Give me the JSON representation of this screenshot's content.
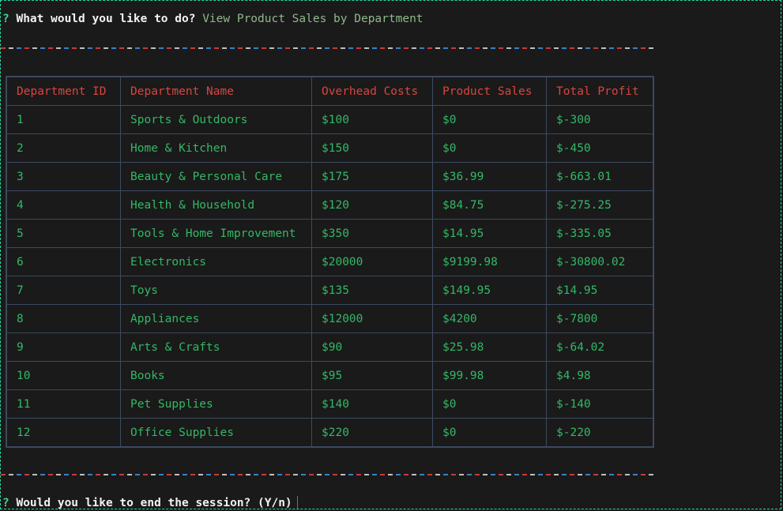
{
  "prompt1": {
    "marker": "?",
    "question": "What would you like to do?",
    "answer": "View Product Sales by Department"
  },
  "table": {
    "headers": [
      "Department ID",
      "Department Name",
      "Overhead Costs",
      "Product Sales",
      "Total Profit"
    ],
    "rows": [
      [
        "1",
        "Sports & Outdoors",
        "$100",
        "$0",
        "$-300"
      ],
      [
        "2",
        "Home & Kitchen",
        "$150",
        "$0",
        "$-450"
      ],
      [
        "3",
        "Beauty & Personal Care",
        "$175",
        "$36.99",
        "$-663.01"
      ],
      [
        "4",
        "Health & Household",
        "$120",
        "$84.75",
        "$-275.25"
      ],
      [
        "5",
        "Tools & Home Improvement",
        "$350",
        "$14.95",
        "$-335.05"
      ],
      [
        "6",
        "Electronics",
        "$20000",
        "$9199.98",
        "$-30800.02"
      ],
      [
        "7",
        "Toys",
        "$135",
        "$149.95",
        "$14.95"
      ],
      [
        "8",
        "Appliances",
        "$12000",
        "$4200",
        "$-7800"
      ],
      [
        "9",
        "Arts & Crafts",
        "$90",
        "$25.98",
        "$-64.02"
      ],
      [
        "10",
        "Books",
        "$95",
        "$99.98",
        "$4.98"
      ],
      [
        "11",
        "Pet Supplies",
        "$140",
        "$0",
        "$-140"
      ],
      [
        "12",
        "Office Supplies",
        "$220",
        "$0",
        "$-220"
      ]
    ]
  },
  "prompt2": {
    "marker": "?",
    "question": "Would you like to end the session? (Y/n)"
  },
  "colors": {
    "background": "#1a1a1a",
    "header_text": "#d9453f",
    "cell_text": "#33b866",
    "border": "#3c4a60",
    "terminal_border": "#26d9a0"
  }
}
